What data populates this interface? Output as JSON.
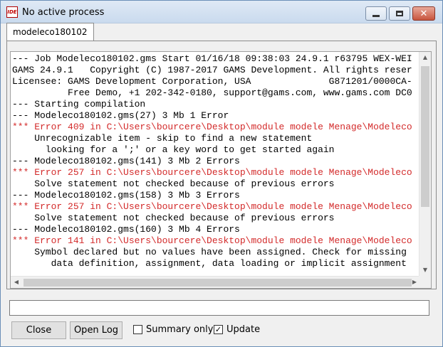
{
  "window": {
    "app_icon_text": "IDE",
    "title": "No active process"
  },
  "tabs": [
    {
      "label": "modeleco180102"
    }
  ],
  "log": {
    "lines": [
      {
        "text": "--- Job Modeleco180102.gms Start 01/16/18 09:38:03 24.9.1 r63795 WEX-WEI",
        "type": "normal"
      },
      {
        "text": "GAMS 24.9.1   Copyright (C) 1987-2017 GAMS Development. All rights reser",
        "type": "normal"
      },
      {
        "text": "Licensee: GAMS Development Corporation, USA              G871201/0000CA-",
        "type": "normal"
      },
      {
        "text": "          Free Demo, +1 202-342-0180, support@gams.com, www.gams.com DC0",
        "type": "normal"
      },
      {
        "text": "--- Starting compilation",
        "type": "normal"
      },
      {
        "text": "--- Modeleco180102.gms(27) 3 Mb 1 Error",
        "type": "normal"
      },
      {
        "text": "*** Error 409 in C:\\Users\\bourcere\\Desktop\\module modele Menage\\Modeleco",
        "type": "error"
      },
      {
        "text": "    Unrecognizable item - skip to find a new statement",
        "type": "normal"
      },
      {
        "text": "      looking for a ';' or a key word to get started again",
        "type": "normal"
      },
      {
        "text": "--- Modeleco180102.gms(141) 3 Mb 2 Errors",
        "type": "normal"
      },
      {
        "text": "*** Error 257 in C:\\Users\\bourcere\\Desktop\\module modele Menage\\Modeleco",
        "type": "error"
      },
      {
        "text": "    Solve statement not checked because of previous errors",
        "type": "normal"
      },
      {
        "text": "--- Modeleco180102.gms(158) 3 Mb 3 Errors",
        "type": "normal"
      },
      {
        "text": "*** Error 257 in C:\\Users\\bourcere\\Desktop\\module modele Menage\\Modeleco",
        "type": "error"
      },
      {
        "text": "    Solve statement not checked because of previous errors",
        "type": "normal"
      },
      {
        "text": "--- Modeleco180102.gms(160) 3 Mb 4 Errors",
        "type": "normal"
      },
      {
        "text": "*** Error 141 in C:\\Users\\bourcere\\Desktop\\module modele Menage\\Modeleco",
        "type": "error"
      },
      {
        "text": "    Symbol declared but no values have been assigned. Check for missing",
        "type": "normal"
      },
      {
        "text": "       data definition, assignment, data loading or implicit assignment",
        "type": "normal"
      }
    ]
  },
  "command_input": {
    "value": ""
  },
  "buttons": {
    "close": "Close",
    "open_log": "Open Log"
  },
  "options": {
    "summary_only": {
      "label": "Summary only",
      "checked": false
    },
    "update": {
      "label": "Update",
      "checked": true
    }
  },
  "colors": {
    "error_text": "#d32a2a",
    "normal_text": "#000000"
  }
}
